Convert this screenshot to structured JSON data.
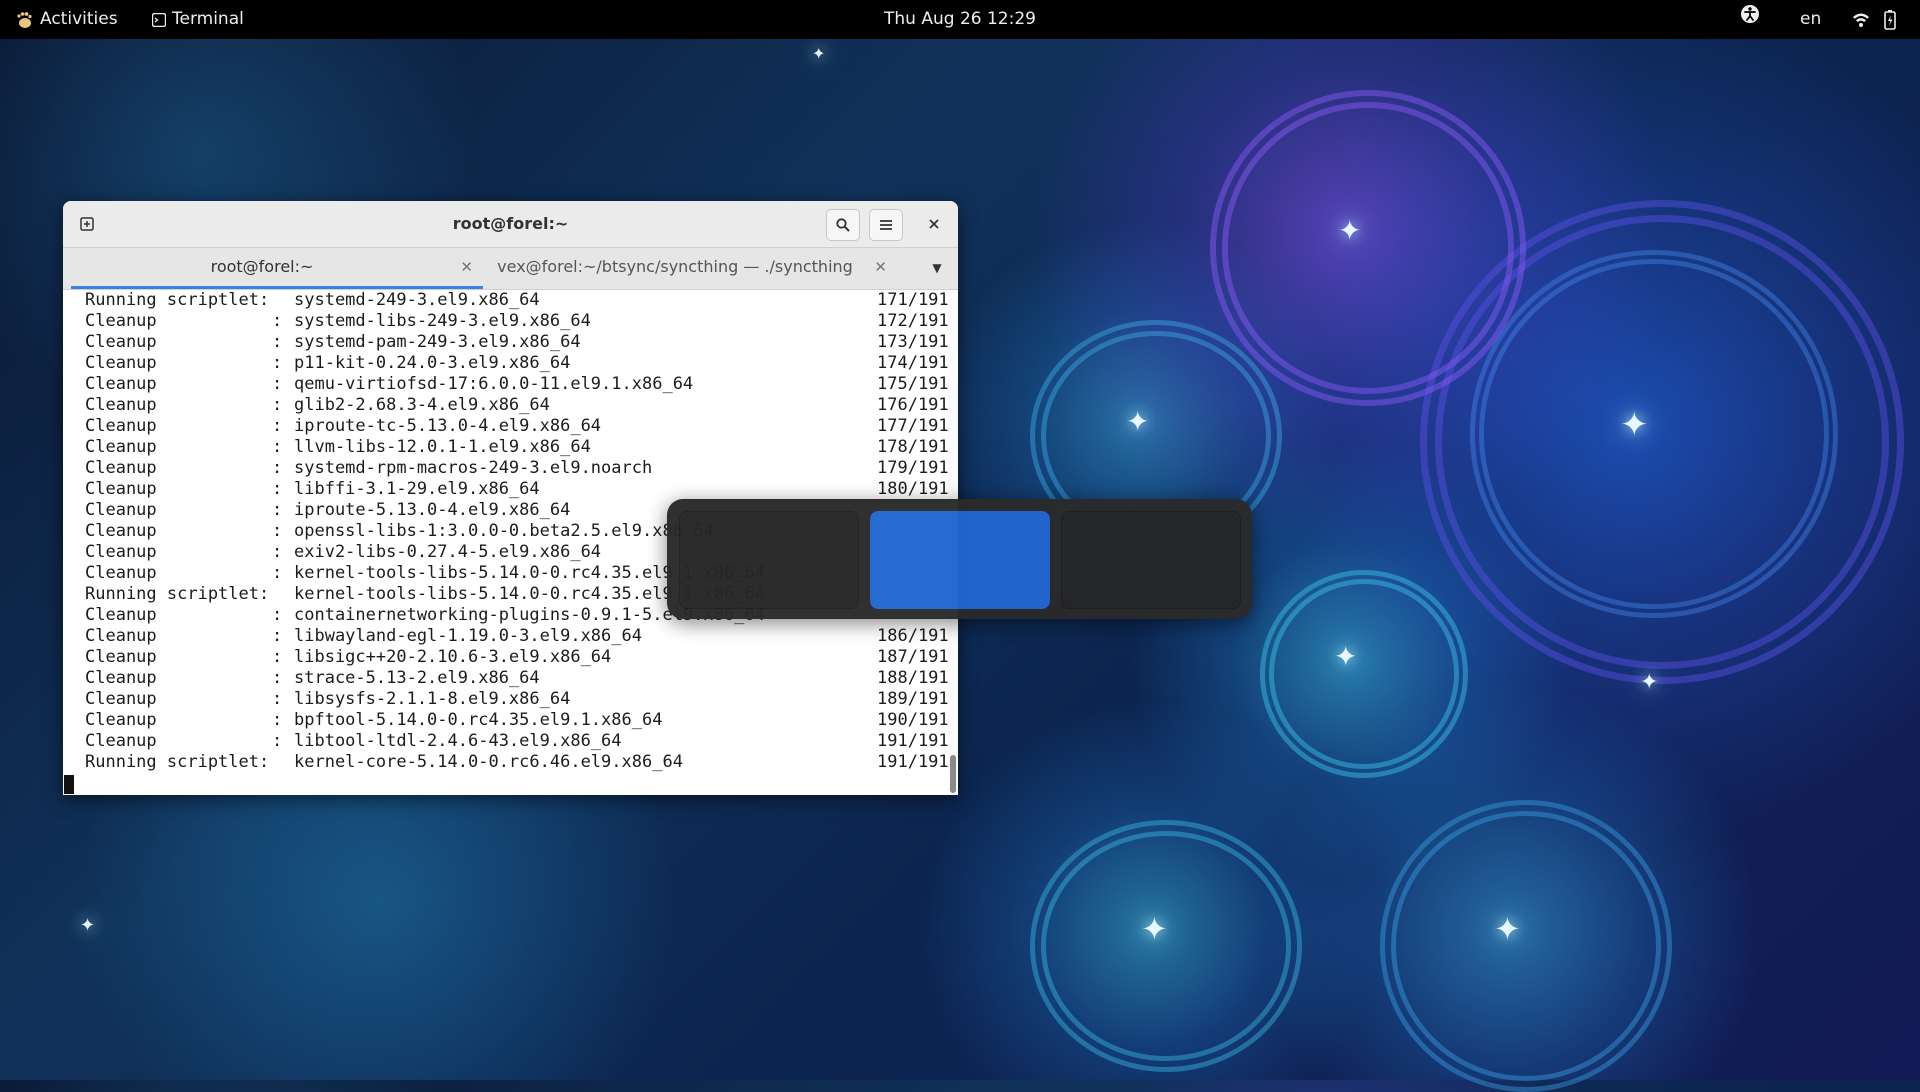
{
  "topbar": {
    "activities_label": "Activities",
    "app_label": "Terminal",
    "clock": "Thu Aug 26  12:29",
    "language": "en",
    "icons": [
      "accessibility-icon",
      "wifi-icon",
      "battery-icon"
    ]
  },
  "window": {
    "title": "root@forel:~",
    "tabs": [
      {
        "label": "root@forel:~",
        "active": true
      },
      {
        "label": "vex@forel:~/btsync/syncthing — ./syncthing",
        "active": false
      }
    ],
    "lines": [
      {
        "action": "Running scriptlet:",
        "colon": "",
        "pkg": "systemd-249-3.el9.x86_64",
        "progress": "171/191"
      },
      {
        "action": "Cleanup",
        "colon": ":",
        "pkg": "systemd-libs-249-3.el9.x86_64",
        "progress": "172/191"
      },
      {
        "action": "Cleanup",
        "colon": ":",
        "pkg": "systemd-pam-249-3.el9.x86_64",
        "progress": "173/191"
      },
      {
        "action": "Cleanup",
        "colon": ":",
        "pkg": "p11-kit-0.24.0-3.el9.x86_64",
        "progress": "174/191"
      },
      {
        "action": "Cleanup",
        "colon": ":",
        "pkg": "qemu-virtiofsd-17:6.0.0-11.el9.1.x86_64",
        "progress": "175/191"
      },
      {
        "action": "Cleanup",
        "colon": ":",
        "pkg": "glib2-2.68.3-4.el9.x86_64",
        "progress": "176/191"
      },
      {
        "action": "Cleanup",
        "colon": ":",
        "pkg": "iproute-tc-5.13.0-4.el9.x86_64",
        "progress": "177/191"
      },
      {
        "action": "Cleanup",
        "colon": ":",
        "pkg": "llvm-libs-12.0.1-1.el9.x86_64",
        "progress": "178/191"
      },
      {
        "action": "Cleanup",
        "colon": ":",
        "pkg": "systemd-rpm-macros-249-3.el9.noarch",
        "progress": "179/191"
      },
      {
        "action": "Cleanup",
        "colon": ":",
        "pkg": "libffi-3.1-29.el9.x86_64",
        "progress": "180/191"
      },
      {
        "action": "Cleanup",
        "colon": ":",
        "pkg": "iproute-5.13.0-4.el9.x86_64",
        "progress": ""
      },
      {
        "action": "Cleanup",
        "colon": ":",
        "pkg": "openssl-libs-1:3.0.0-0.beta2.5.el9.x86_64",
        "progress": ""
      },
      {
        "action": "Cleanup",
        "colon": ":",
        "pkg": "exiv2-libs-0.27.4-5.el9.x86_64",
        "progress": ""
      },
      {
        "action": "Cleanup",
        "colon": ":",
        "pkg": "kernel-tools-libs-5.14.0-0.rc4.35.el9.1.x86_64",
        "progress": ""
      },
      {
        "action": "Running scriptlet:",
        "colon": "",
        "pkg": "kernel-tools-libs-5.14.0-0.rc4.35.el9.1.x86_64",
        "progress": ""
      },
      {
        "action": "Cleanup",
        "colon": ":",
        "pkg": "containernetworking-plugins-0.9.1-5.el9.x86_64",
        "progress": ""
      },
      {
        "action": "Cleanup",
        "colon": ":",
        "pkg": "libwayland-egl-1.19.0-3.el9.x86_64",
        "progress": "186/191"
      },
      {
        "action": "Cleanup",
        "colon": ":",
        "pkg": "libsigc++20-2.10.6-3.el9.x86_64",
        "progress": "187/191"
      },
      {
        "action": "Cleanup",
        "colon": ":",
        "pkg": "strace-5.13-2.el9.x86_64",
        "progress": "188/191"
      },
      {
        "action": "Cleanup",
        "colon": ":",
        "pkg": "libsysfs-2.1.1-8.el9.x86_64",
        "progress": "189/191"
      },
      {
        "action": "Cleanup",
        "colon": ":",
        "pkg": "bpftool-5.14.0-0.rc4.35.el9.1.x86_64",
        "progress": "190/191"
      },
      {
        "action": "Cleanup",
        "colon": ":",
        "pkg": "libtool-ltdl-2.4.6-43.el9.x86_64",
        "progress": "191/191"
      },
      {
        "action": "Running scriptlet:",
        "colon": "",
        "pkg": "kernel-core-5.14.0-0.rc6.46.el9.x86_64",
        "progress": "191/191"
      }
    ]
  },
  "workspaces": {
    "count": 3,
    "active_index": 1,
    "active_color": "#2166d0"
  },
  "colors": {
    "accent": "#3584e4",
    "topbar": "#000000"
  }
}
